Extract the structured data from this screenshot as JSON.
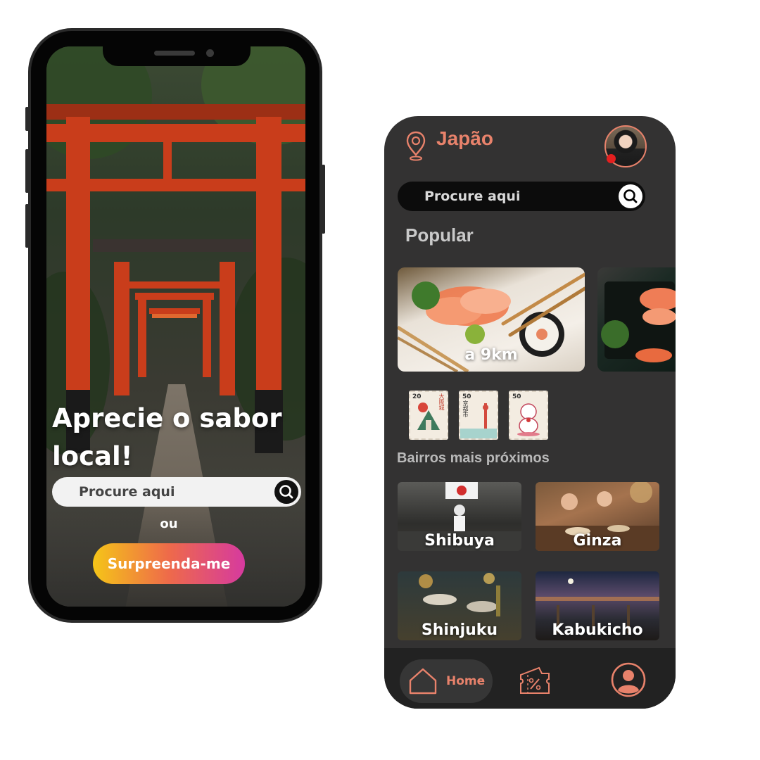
{
  "intro_screen": {
    "headline": "Aprecie o sabor local!",
    "search": {
      "placeholder": "Procure aqui"
    },
    "or_text": "ou",
    "surprise_button": "Surpreenda-me"
  },
  "app_screen": {
    "location_title": "Japão",
    "search": {
      "placeholder": "Procure aqui"
    },
    "popular_heading": "Popular",
    "popular_card": {
      "distance": "a 9km"
    },
    "stamps": [
      {
        "value": "20",
        "kanji": "大阪城"
      },
      {
        "value": "50",
        "kanji": "京都市"
      },
      {
        "value": "50",
        "kanji": ""
      }
    ],
    "neighborhoods_heading": "Bairros mais próximos",
    "neighborhoods": [
      "Shibuya",
      "Ginza",
      "Shinjuku",
      "Kabukicho"
    ],
    "nav": {
      "home_label": "Home"
    }
  },
  "colors": {
    "accent": "#e8826b",
    "app_background": "#333232",
    "navbar": "#222222",
    "notification_dot": "#e41f1f",
    "torii_red": "#c93d1b"
  },
  "icons": [
    "map-pin-icon",
    "search-icon",
    "home-icon",
    "ticket-discount-icon",
    "user-profile-icon"
  ]
}
